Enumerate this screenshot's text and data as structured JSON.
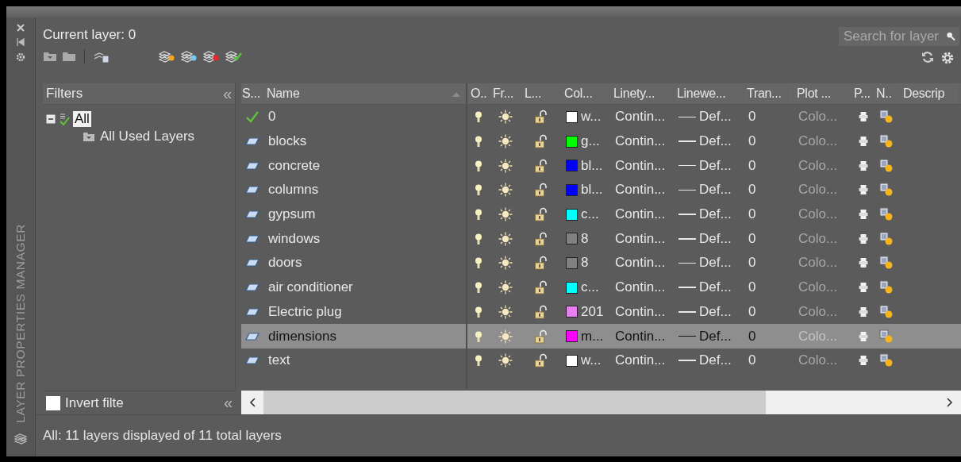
{
  "window": {
    "title": "LAYER PROPERTIES MANAGER"
  },
  "current_layer": "Current layer: 0",
  "search": {
    "placeholder": "Search for layer"
  },
  "filters": {
    "title": "Filters",
    "collapse": "«",
    "tree": [
      {
        "label": "All",
        "selected": true,
        "expanded": true,
        "children": [
          {
            "label": "All Used Layers",
            "selected": false
          }
        ]
      }
    ],
    "invert": {
      "label": "Invert filte",
      "checked": false
    },
    "collapse_bottom": "«"
  },
  "table": {
    "columns": [
      "S...",
      "Name",
      "O..",
      "Fr...",
      "L...",
      "Col...",
      "Linety...",
      "Linewe...",
      "Tran...",
      "Plot ...",
      "P...",
      "N..",
      "Descrip"
    ],
    "rows": [
      {
        "current": true,
        "name": "0",
        "on": true,
        "frozen": false,
        "locked": false,
        "color": "#ffffff",
        "color_name": "w...",
        "linetype": "Contin...",
        "lineweight": "Def...",
        "transparency": "0",
        "plot_style": "Colo...",
        "selected": false
      },
      {
        "current": false,
        "name": "blocks",
        "on": true,
        "frozen": false,
        "locked": false,
        "color": "#00ff00",
        "color_name": "g...",
        "linetype": "Contin...",
        "lineweight": "Def...",
        "transparency": "0",
        "plot_style": "Colo...",
        "selected": false
      },
      {
        "current": false,
        "name": "concrete",
        "on": true,
        "frozen": false,
        "locked": false,
        "color": "#0000ff",
        "color_name": "bl...",
        "linetype": "Contin...",
        "lineweight": "Def...",
        "transparency": "0",
        "plot_style": "Colo...",
        "selected": false
      },
      {
        "current": false,
        "name": "columns",
        "on": true,
        "frozen": false,
        "locked": false,
        "color": "#0000ff",
        "color_name": "bl...",
        "linetype": "Contin...",
        "lineweight": "Def...",
        "transparency": "0",
        "plot_style": "Colo...",
        "selected": false
      },
      {
        "current": false,
        "name": "gypsum",
        "on": true,
        "frozen": false,
        "locked": false,
        "color": "#00ffff",
        "color_name": "c...",
        "linetype": "Contin...",
        "lineweight": "Def...",
        "transparency": "0",
        "plot_style": "Colo...",
        "selected": false
      },
      {
        "current": false,
        "name": "windows",
        "on": true,
        "frozen": false,
        "locked": false,
        "color": "#808080",
        "color_name": "8",
        "linetype": "Contin...",
        "lineweight": "Def...",
        "transparency": "0",
        "plot_style": "Colo...",
        "selected": false
      },
      {
        "current": false,
        "name": "doors",
        "on": true,
        "frozen": false,
        "locked": false,
        "color": "#808080",
        "color_name": "8",
        "linetype": "Contin...",
        "lineweight": "Def...",
        "transparency": "0",
        "plot_style": "Colo...",
        "selected": false
      },
      {
        "current": false,
        "name": "air conditioner",
        "on": true,
        "frozen": false,
        "locked": false,
        "color": "#00ffff",
        "color_name": "c...",
        "linetype": "Contin...",
        "lineweight": "Def...",
        "transparency": "0",
        "plot_style": "Colo...",
        "selected": false
      },
      {
        "current": false,
        "name": "Electric plug",
        "on": true,
        "frozen": false,
        "locked": false,
        "color": "#e680f0",
        "color_name": "201",
        "linetype": "Contin...",
        "lineweight": "Def...",
        "transparency": "0",
        "plot_style": "Colo...",
        "selected": false
      },
      {
        "current": false,
        "name": "dimensions",
        "on": true,
        "frozen": false,
        "locked": false,
        "color": "#ff00ff",
        "color_name": "m...",
        "linetype": "Contin...",
        "lineweight": "Def...",
        "transparency": "0",
        "plot_style": "Colo...",
        "selected": true
      },
      {
        "current": false,
        "name": "text",
        "on": true,
        "frozen": false,
        "locked": false,
        "color": "#ffffff",
        "color_name": "w...",
        "linetype": "Contin...",
        "lineweight": "Def...",
        "transparency": "0",
        "plot_style": "Colo...",
        "selected": false
      }
    ]
  },
  "status_bar": "All: 11 layers displayed of 11 total layers"
}
